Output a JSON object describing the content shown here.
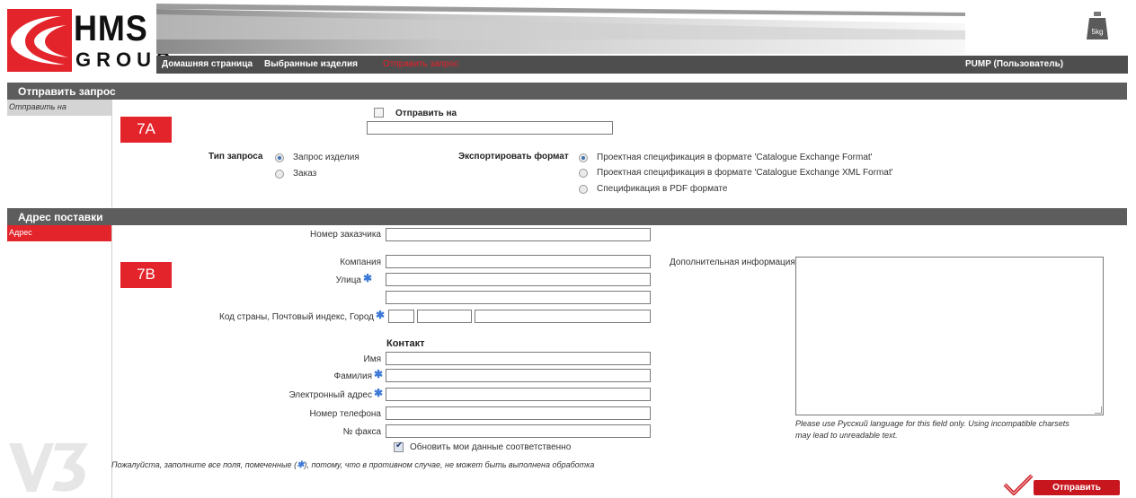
{
  "header": {
    "logo_text_top": "HMS",
    "logo_text_bottom": "GROUP",
    "weight_icon_text": "5kg",
    "nav": [
      "Домашняя страница",
      "Выбранные изделия",
      "Отправить запрос"
    ],
    "user": "PUMP (Пользователь)"
  },
  "section1": {
    "title": "Отправить запрос",
    "side_item": "Отправить на",
    "badge": "7A",
    "send_to_label": "Отправить на",
    "request_type_label": "Тип запроса",
    "request_types": [
      "Запрос изделия",
      "Заказ"
    ],
    "export_label": "Экспортировать формат",
    "export_formats": [
      "Проектная спецификация в формате 'Catalogue Exchange Format'",
      "Проектная спецификация в формате 'Catalogue Exchange XML Format'",
      "Спецификация в PDF формате"
    ]
  },
  "section2": {
    "title": "Адрес поставки",
    "side_item": "Адрес",
    "badge": "7B",
    "customer_number": "Номер заказчика",
    "company": "Компания",
    "street": "Улица",
    "country_zip_city": "Код страны, Почтовый индекс, Город",
    "contact_heading": "Контакт",
    "first_name": "Имя",
    "last_name": "Фамилия",
    "email": "Электронный адрес",
    "phone": "Номер телефона",
    "fax": "№ факса",
    "update_label": "Обновить мои данные соответственно",
    "additional_info": "Дополнительная информация",
    "charset_note_1": "Please use Русский language for this field only. Using incompatible charsets",
    "charset_note_2": "may lead to unreadable text.",
    "required_note_1": "Пожалуйста, заполните все поля, помеченные (",
    "required_note_2": "), потому, что в противном случае, не может быть выполнена обработка",
    "submit": "Отправить"
  },
  "watermark": "V3"
}
